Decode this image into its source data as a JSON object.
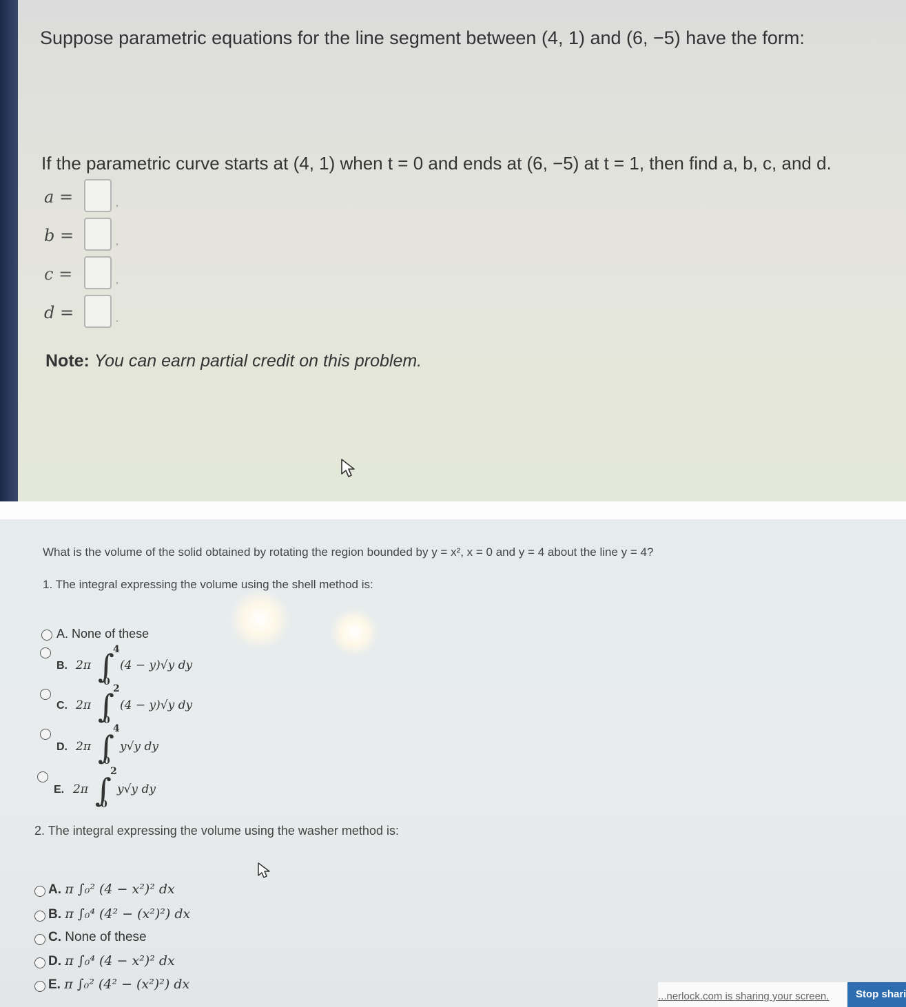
{
  "top": {
    "intro": "Suppose parametric equations for the line segment between (4, 1) and (6, −5) have the form:",
    "instruction": "If the parametric curve starts at (4, 1) when t = 0 and ends at (6, −5) at t = 1, then find a, b, c, and d.",
    "fields": [
      {
        "label": "a =",
        "value": "",
        "suffix": ","
      },
      {
        "label": "b =",
        "value": "",
        "suffix": ","
      },
      {
        "label": "c =",
        "value": "",
        "suffix": ","
      },
      {
        "label": "d =",
        "value": "",
        "suffix": "."
      }
    ],
    "note_label": "Note:",
    "note_text": "You can earn partial credit on this problem."
  },
  "bottom": {
    "question": "What is the volume of the solid obtained by rotating the region bounded by y = x², x = 0 and y = 4 about the line y = 4?",
    "part1": "1. The integral expressing the volume using the shell method is:",
    "shell_options": [
      {
        "letter": "A.",
        "text": "None of these"
      },
      {
        "letter": "B.",
        "coef": "2π",
        "lower": "0",
        "upper": "4",
        "integrand": "(4 − y)√y dy"
      },
      {
        "letter": "C.",
        "coef": "2π",
        "lower": "0",
        "upper": "2",
        "integrand": "(4 − y)√y dy"
      },
      {
        "letter": "D.",
        "coef": "2π",
        "lower": "0",
        "upper": "4",
        "integrand": "y√y dy"
      },
      {
        "letter": "E.",
        "coef": "2π",
        "lower": "0",
        "upper": "2",
        "integrand": "y√y dy"
      }
    ],
    "part2": "2. The integral expressing the volume using the washer method is:",
    "washer_options": [
      {
        "letter": "A.",
        "expr": "π ∫₀² (4 − x²)² dx"
      },
      {
        "letter": "B.",
        "expr": "π ∫₀⁴ (4² − (x²)²) dx"
      },
      {
        "letter": "C.",
        "expr": "None of these"
      },
      {
        "letter": "D.",
        "expr": "π ∫₀⁴ (4 − x²)² dx"
      },
      {
        "letter": "E.",
        "expr": "π ∫₀² (4² − (x²)²) dx"
      }
    ]
  },
  "screen_share": {
    "message": "...nerlock.com is sharing your screen.",
    "stop_label": "Stop sharin"
  },
  "colors": {
    "text": "#333333",
    "stop_button": "#2e6db0"
  }
}
